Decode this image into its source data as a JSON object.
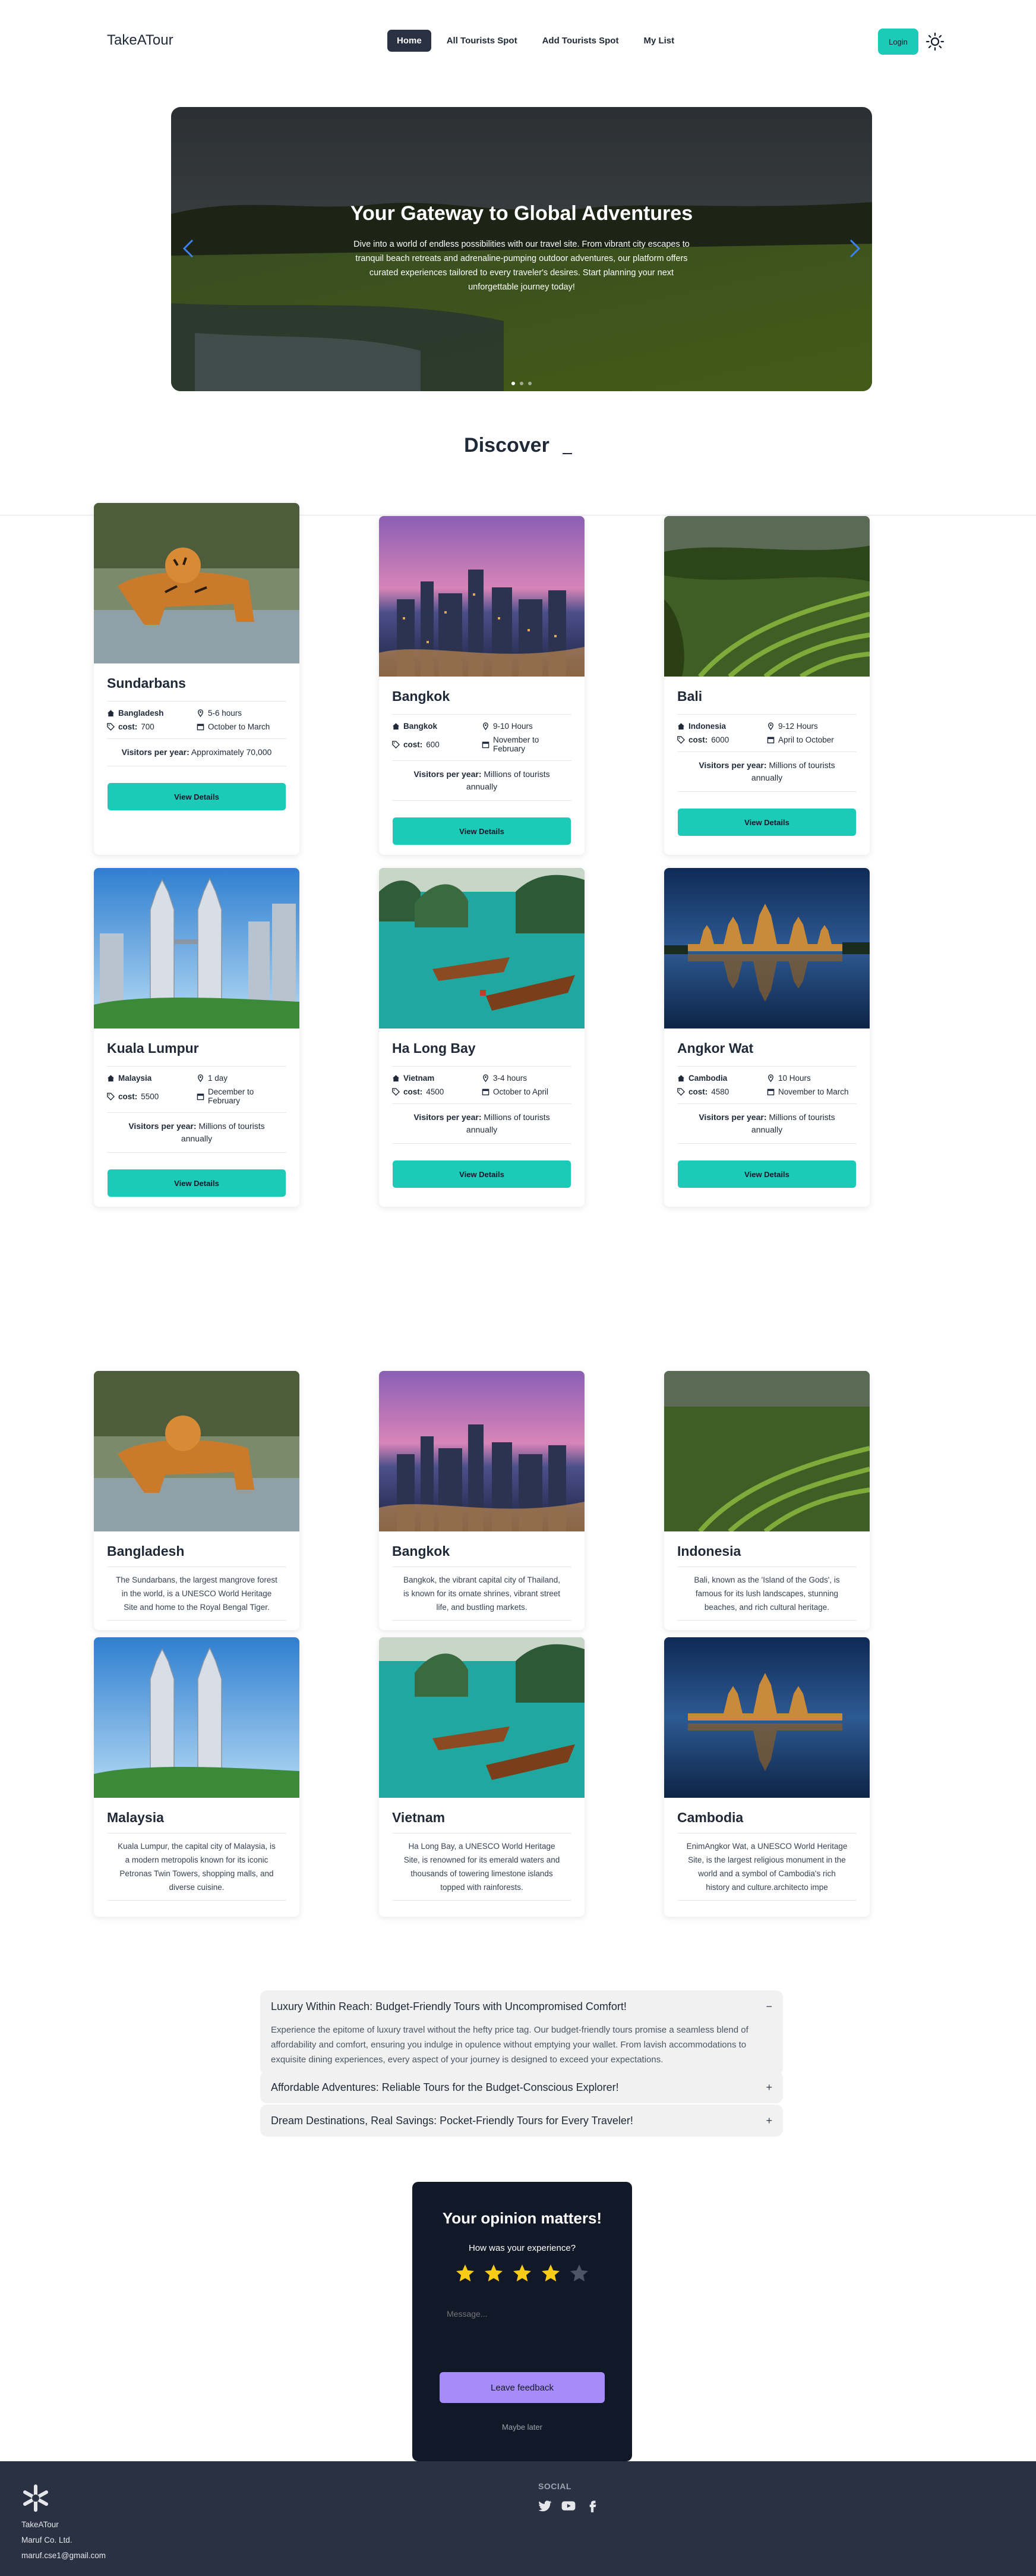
{
  "nav": {
    "brand": "TakeATour",
    "links": [
      "Home",
      "All Tourists Spot",
      "Add Tourists Spot",
      "My List"
    ],
    "login": "Login",
    "theme_icon": "sun-icon"
  },
  "hero": {
    "title": "Your Gateway to Global Adventures",
    "text": "Dive into a world of endless possibilities with our travel site. From vibrant city escapes to tranquil beach retreats and adrenaline-pumping outdoor adventures, our platform offers curated experiences tailored to every traveler's desires. Start planning your next unforgettable journey today!"
  },
  "discover": {
    "title": "Discover",
    "cursor": "_"
  },
  "spots": {
    "visitors_label": "Visitors per year:",
    "cost_label": "cost:",
    "button": "View Details",
    "items": [
      {
        "name": "Sundarbans",
        "country": "Bangladesh",
        "duration": "5-6 hours",
        "cost": "700",
        "season": "October to March",
        "visitors": "Approximately 70,000"
      },
      {
        "name": "Bangkok",
        "country": "Bangkok",
        "duration": "9-10 Hours",
        "cost": "600",
        "season": "November to February",
        "visitors": "Millions of tourists annually"
      },
      {
        "name": "Bali",
        "country": "Indonesia",
        "duration": "9-12 Hours",
        "cost": "6000",
        "season": "April to October",
        "visitors": "Millions of tourists annually"
      },
      {
        "name": "Kuala Lumpur",
        "country": "Malaysia",
        "duration": "1 day",
        "cost": "5500",
        "season": "December to February",
        "visitors": "Millions of tourists annually"
      },
      {
        "name": "Ha Long Bay",
        "country": "Vietnam",
        "duration": "3-4 hours",
        "cost": "4500",
        "season": "October to April",
        "visitors": "Millions of tourists annually"
      },
      {
        "name": "Angkor Wat",
        "country": "Cambodia",
        "duration": "10 Hours",
        "cost": "4580",
        "season": "November to March",
        "visitors": "Millions of tourists annually"
      }
    ]
  },
  "countries": [
    {
      "name": "Bangladesh",
      "text": "The Sundarbans, the largest mangrove forest in the world, is a UNESCO World Heritage Site and home to the Royal Bengal Tiger."
    },
    {
      "name": "Bangkok",
      "text": "Bangkok, the vibrant capital city of Thailand, is known for its ornate shrines, vibrant street life, and bustling markets."
    },
    {
      "name": "Indonesia",
      "text": "Bali, known as the 'Island of the Gods', is famous for its lush landscapes, stunning beaches, and rich cultural heritage."
    },
    {
      "name": "Malaysia",
      "text": "Kuala Lumpur, the capital city of Malaysia, is a modern metropolis known for its iconic Petronas Twin Towers, shopping malls, and diverse cuisine."
    },
    {
      "name": "Vietnam",
      "text": "Ha Long Bay, a UNESCO World Heritage Site, is renowned for its emerald waters and thousands of towering limestone islands topped with rainforests."
    },
    {
      "name": "Cambodia",
      "text": "EnimAngkor Wat, a UNESCO World Heritage Site, is the largest religious monument in the world and a symbol of Cambodia's rich history and culture.architecto impe"
    }
  ],
  "faq": [
    {
      "q": "Luxury Within Reach: Budget-Friendly Tours with Uncompromised Comfort!",
      "sign": "−",
      "a": "Experience the epitome of luxury travel without the hefty price tag. Our budget-friendly tours promise a seamless blend of affordability and comfort, ensuring you indulge in opulence without emptying your wallet. From lavish accommodations to exquisite dining experiences, every aspect of your journey is designed to exceed your expectations."
    },
    {
      "q": "Affordable Adventures: Reliable Tours for the Budget-Conscious Explorer!",
      "sign": "+"
    },
    {
      "q": "Dream Destinations, Real Savings: Pocket-Friendly Tours for Every Traveler!",
      "sign": "+"
    }
  ],
  "feedback": {
    "title": "Your opinion matters!",
    "question": "How was your experience?",
    "rating": 4,
    "max_rating": 5,
    "placeholder": "Message...",
    "button": "Leave feedback",
    "later": "Maybe later"
  },
  "footer": {
    "company": "TakeATour",
    "line2": "Maruf Co. Ltd.",
    "email": "maruf.cse1@gmail.com",
    "social_title": "SOCIAL",
    "icons": [
      "twitter-icon",
      "youtube-icon",
      "facebook-icon"
    ]
  },
  "colors": {
    "accent": "#1ccbb7",
    "nav_active": "#2a3142",
    "feedback_bg": "#111827",
    "feedback_btn": "#a78bfa",
    "star": "#facc15"
  }
}
